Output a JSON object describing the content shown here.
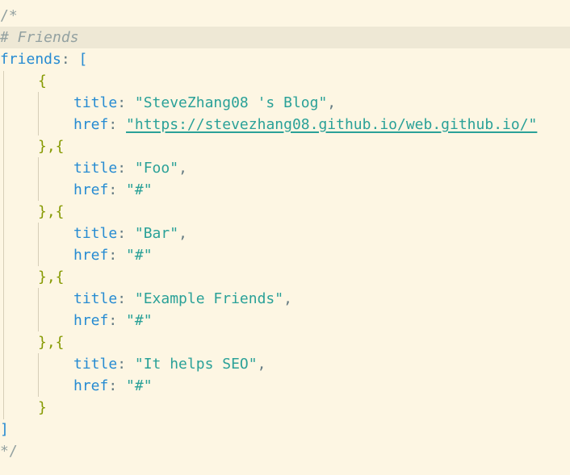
{
  "editor": {
    "comment_open": "/*",
    "heading": "# Friends",
    "array_key": "friends",
    "array_open": "[",
    "array_close": "]",
    "comment_close": "*/",
    "colon": ":",
    "comma": ",",
    "brace_open": "{",
    "brace_close": "}",
    "brace_join": "},{",
    "title_key": "title",
    "href_key": "href",
    "entries": [
      {
        "title": "\"SteveZhang08 's Blog\"",
        "href": "\"https://stevezhang08.github.io/web.github.io/\""
      },
      {
        "title": "\"Foo\"",
        "href": "\"#\""
      },
      {
        "title": "\"Bar\"",
        "href": "\"#\""
      },
      {
        "title": "\"Example Friends\"",
        "href": "\"#\""
      },
      {
        "title": "\"It helps SEO\"",
        "href": "\"#\""
      }
    ]
  },
  "colors": {
    "background": "#fdf6e3",
    "highlight_line": "#eee8d5",
    "comment": "#93a1a1",
    "key": "#268bd2",
    "string": "#2aa198",
    "brace": "#859900"
  }
}
